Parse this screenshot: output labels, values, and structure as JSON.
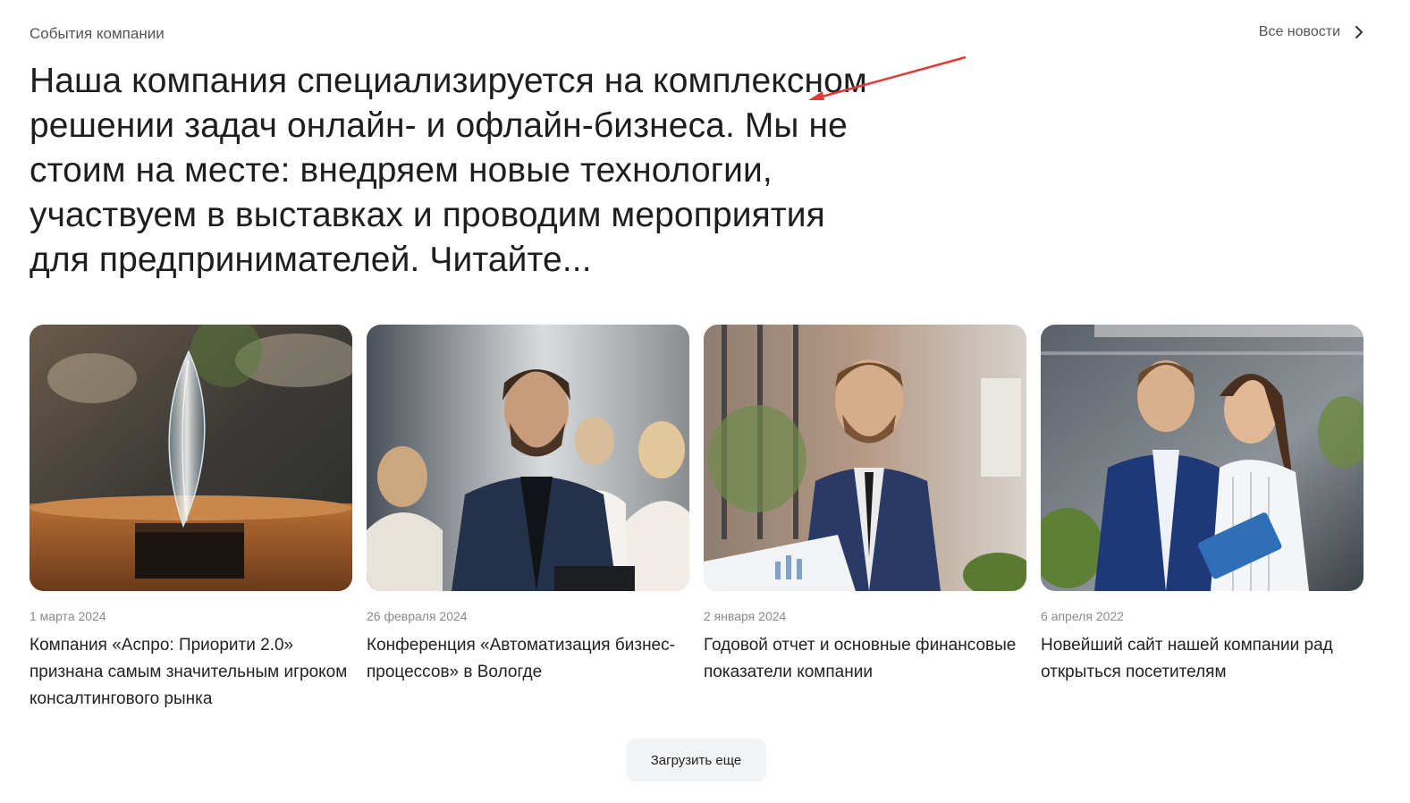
{
  "header": {
    "section_label": "События компании",
    "all_news_label": "Все новости",
    "all_news_icon": "chevron-right-icon"
  },
  "intro_text": "Наша компания специализируется на комплексном решении задач онлайн- и офлайн-бизнеса. Мы не стоим на месте: внедряем новые технологии, участвуем в выставках и проводим мероприятия для предпринимателей. Читайте...",
  "annotation": {
    "arrow_color": "#e53935"
  },
  "news": [
    {
      "date": "1 марта 2024",
      "title": "Компания «Аспро: Приорити 2.0» признана самым значительным игроком консалтингового рынка"
    },
    {
      "date": "26 февраля 2024",
      "title": "Конференция «Автоматизация бизнес-процессов» в Вологде"
    },
    {
      "date": "2 января 2024",
      "title": "Годовой отчет и основные финансовые показатели компании"
    },
    {
      "date": "6 апреля 2022",
      "title": "Новейший сайт нашей компании рад открыться посетителям"
    }
  ],
  "load_more_label": "Загрузить еще"
}
